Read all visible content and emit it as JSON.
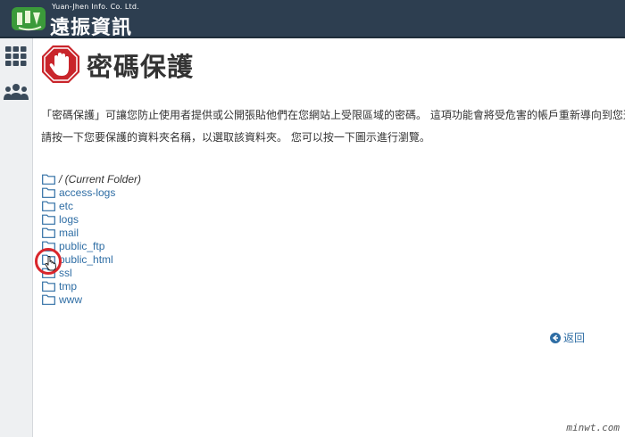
{
  "header": {
    "brand_en": "Yuan-Jhen Info. Co. Ltd.",
    "brand_zh": "遠振資訊",
    "accent": "#2d3e50"
  },
  "sidebar": {
    "items": [
      {
        "icon": "grid-icon"
      },
      {
        "icon": "users-icon"
      }
    ]
  },
  "page": {
    "title": "密碼保護",
    "title_icon": "stop-hand-icon",
    "description_1": "「密碼保護」可讓您防止使用者提供或公開張貼他們在您網站上受限區域的密碼。 這項功能會將受危害的帳戶重新導向到您選擇",
    "description_2": "請按一下您要保護的資料夾名稱，以選取該資料夾。 您可以按一下圖示進行瀏覽。"
  },
  "folders": [
    {
      "name": "/ (Current Folder)",
      "current": true
    },
    {
      "name": "access-logs"
    },
    {
      "name": "etc"
    },
    {
      "name": "logs"
    },
    {
      "name": "mail"
    },
    {
      "name": "public_ftp"
    },
    {
      "name": "public_html",
      "highlighted": true
    },
    {
      "name": "ssl"
    },
    {
      "name": "tmp"
    },
    {
      "name": "www"
    }
  ],
  "back": {
    "label": "返回",
    "icon": "circle-arrow-left-icon"
  },
  "watermark": "minwt.com",
  "colors": {
    "link": "#2e6da4",
    "highlight": "#d9262c"
  }
}
